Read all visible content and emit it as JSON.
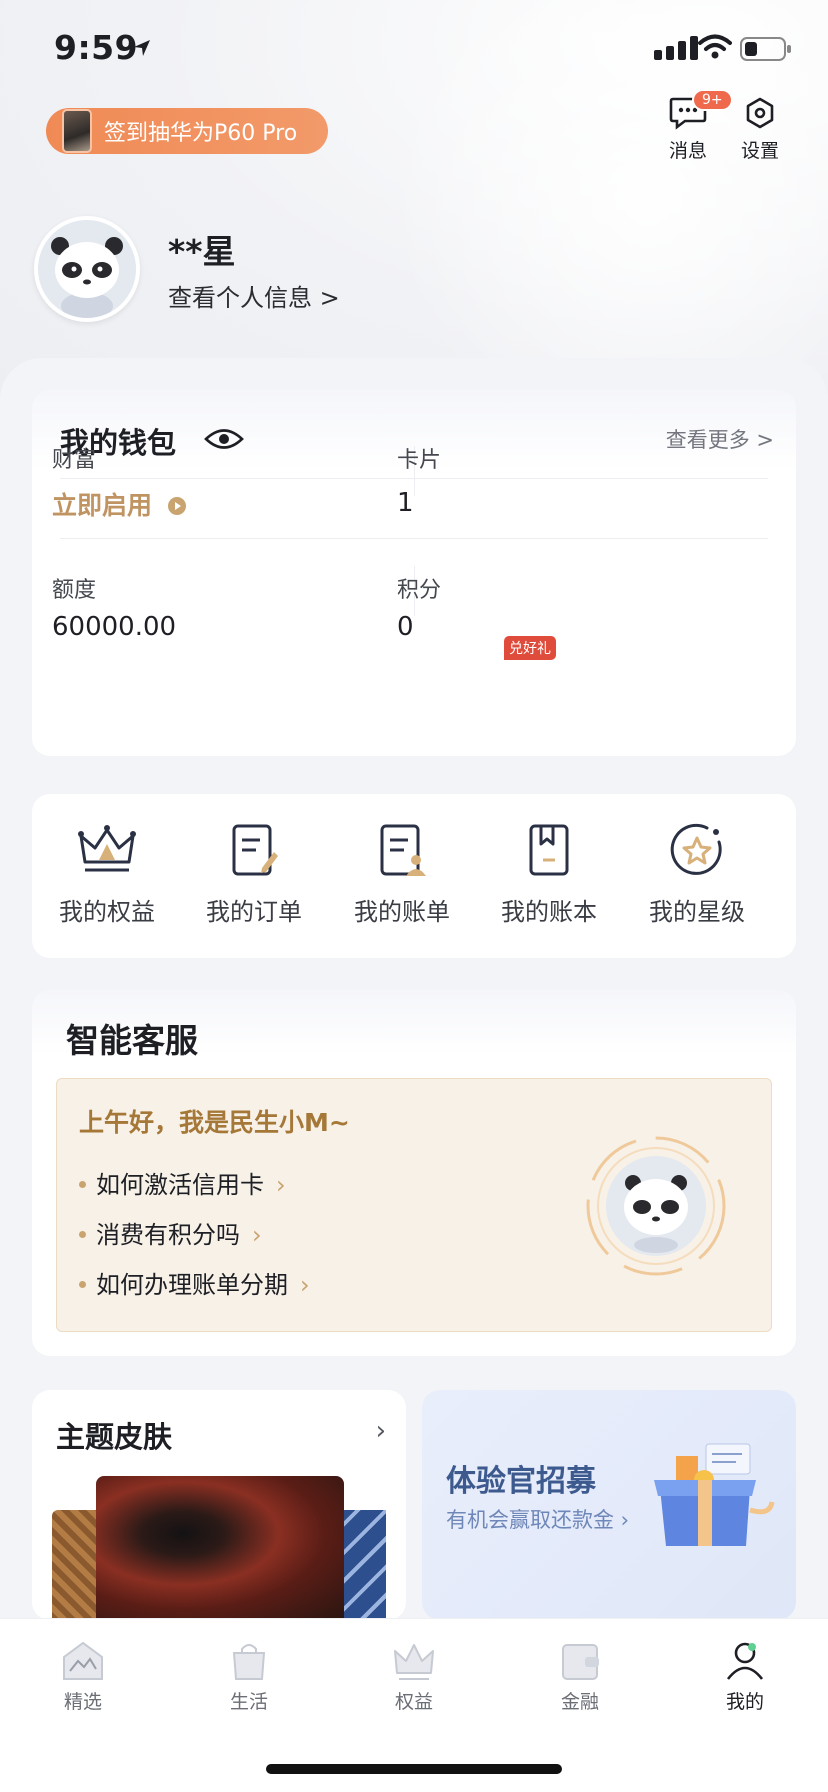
{
  "status_bar": {
    "time": "9:59"
  },
  "header": {
    "promo_text": "签到抽华为P60 Pro",
    "messages_label": "消息",
    "messages_badge": "9+",
    "settings_label": "设置"
  },
  "profile": {
    "name": "**星",
    "view_info": "查看个人信息 >"
  },
  "wallet": {
    "title": "我的钱包",
    "see_more": "查看更多 >",
    "wealth_label": "财富",
    "wealth_value": "立即启用",
    "card_label": "卡片",
    "card_value": "1",
    "limit_label": "额度",
    "limit_value": "60000.00",
    "points_label": "积分",
    "points_badge": "兑好礼",
    "points_value": "0"
  },
  "shortcuts": [
    {
      "label": "我的权益",
      "icon": "crown-icon"
    },
    {
      "label": "我的订单",
      "icon": "order-icon"
    },
    {
      "label": "我的账单",
      "icon": "bill-icon"
    },
    {
      "label": "我的账本",
      "icon": "ledger-icon"
    },
    {
      "label": "我的星级",
      "icon": "star-level-icon"
    }
  ],
  "assistant": {
    "title": "智能客服",
    "greeting": "上午好，我是民生小M~",
    "faqs": [
      "如何激活信用卡",
      "消费有积分吗",
      "如何办理账单分期"
    ]
  },
  "theme_skin": {
    "title": "主题皮肤"
  },
  "experience": {
    "title": "体验官招募",
    "subtitle": "有机会赢取还款金"
  },
  "tabbar": [
    {
      "label": "精选",
      "icon": "home-icon"
    },
    {
      "label": "生活",
      "icon": "bag-icon"
    },
    {
      "label": "权益",
      "icon": "crown-icon"
    },
    {
      "label": "金融",
      "icon": "wallet-icon"
    },
    {
      "label": "我的",
      "icon": "user-icon",
      "active": true
    }
  ],
  "colors": {
    "accent_gold": "#c09462",
    "promo_orange": "#f08a55",
    "badge_red": "#e04c3b",
    "exp_blue": "#3d5a8e"
  }
}
